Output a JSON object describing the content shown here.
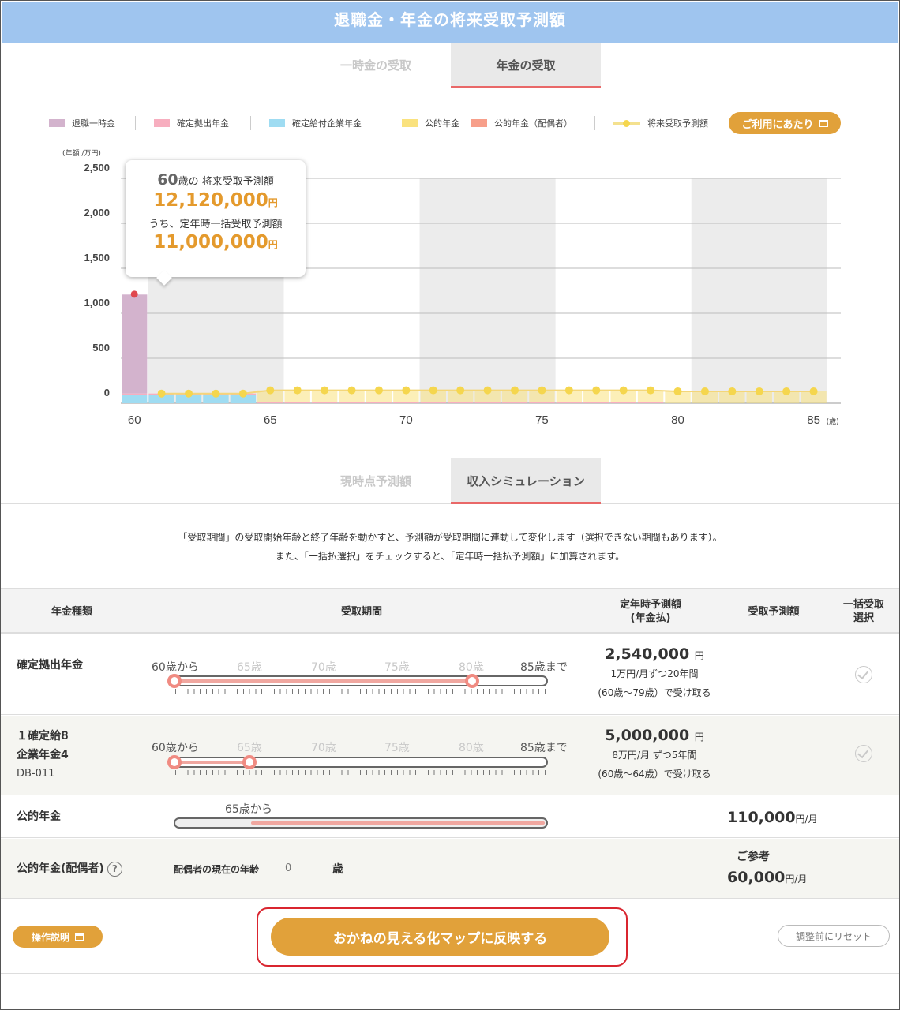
{
  "title": "退職金・年金の将来受取予測額",
  "top_tabs": [
    {
      "label": "一時金の受取",
      "active": false
    },
    {
      "label": "年金の受取",
      "active": true
    }
  ],
  "legend": {
    "items": [
      {
        "label": "退職一時金",
        "color": "#d3b3cd"
      },
      {
        "label": "確定拠出年金",
        "color": "#f7aebf"
      },
      {
        "label": "確定給付企業年金",
        "color": "#9fdcf2"
      },
      {
        "label": "公的年金",
        "color": "#fae27e"
      },
      {
        "label": "公的年金（配偶者）",
        "color": "#f79f8a"
      },
      {
        "label": "将来受取予測額",
        "color": "#f5d64e"
      }
    ],
    "usage_button": "ご利用にあたり"
  },
  "tooltip": {
    "age": "60",
    "age_suffix": "歳の 将来受取予測額",
    "total": "12,120,000",
    "yen": "円",
    "lump_label": "うち、定年時一括受取予測額",
    "lump": "11,000,000"
  },
  "chart_data": {
    "type": "bar",
    "y_unit_label": "(年額 /万円)",
    "x_unit_label": "(歳)",
    "ylim": [
      0,
      2500
    ],
    "y_ticks": [
      0,
      500,
      1000,
      1500,
      2000,
      2500
    ],
    "y_tick_labels": [
      "0",
      "500",
      "1,000",
      "1,500",
      "2,000",
      "2,500"
    ],
    "x_ticks": [
      60,
      65,
      70,
      75,
      80,
      85
    ],
    "x_tick_labels": [
      "60",
      "65",
      "70",
      "75",
      "80",
      "85"
    ],
    "xlim": [
      59.5,
      86
    ],
    "grid": true,
    "shaded_age_bands": [
      [
        60.5,
        65.5
      ],
      [
        70.5,
        75.5
      ],
      [
        80.5,
        85.5
      ]
    ],
    "series": [
      {
        "name": "退職一時金",
        "color": "#d3b3cd",
        "values": [
          {
            "age": 60,
            "value": 1100
          }
        ]
      },
      {
        "name": "確定給付企業年金",
        "color": "#9fdcf2",
        "values": [
          {
            "age": 60,
            "value": 96
          },
          {
            "age": 61,
            "value": 96
          },
          {
            "age": 62,
            "value": 96
          },
          {
            "age": 63,
            "value": 96
          },
          {
            "age": 64,
            "value": 96
          }
        ]
      },
      {
        "name": "確定拠出年金",
        "color": "#f7aebf",
        "values": [
          {
            "age": 60,
            "value": 12
          },
          {
            "age": 61,
            "value": 12
          },
          {
            "age": 62,
            "value": 12
          },
          {
            "age": 63,
            "value": 12
          },
          {
            "age": 64,
            "value": 12
          },
          {
            "age": 65,
            "value": 12
          },
          {
            "age": 66,
            "value": 12
          },
          {
            "age": 67,
            "value": 12
          },
          {
            "age": 68,
            "value": 12
          },
          {
            "age": 69,
            "value": 12
          },
          {
            "age": 70,
            "value": 12
          },
          {
            "age": 71,
            "value": 12
          },
          {
            "age": 72,
            "value": 12
          },
          {
            "age": 73,
            "value": 12
          },
          {
            "age": 74,
            "value": 12
          },
          {
            "age": 75,
            "value": 12
          },
          {
            "age": 76,
            "value": 12
          },
          {
            "age": 77,
            "value": 12
          },
          {
            "age": 78,
            "value": 12
          },
          {
            "age": 79,
            "value": 12
          }
        ]
      },
      {
        "name": "公的年金",
        "color": "#fae27e",
        "values": [
          {
            "age": 65,
            "value": 132
          },
          {
            "age": 66,
            "value": 132
          },
          {
            "age": 67,
            "value": 132
          },
          {
            "age": 68,
            "value": 132
          },
          {
            "age": 69,
            "value": 132
          },
          {
            "age": 70,
            "value": 132
          },
          {
            "age": 71,
            "value": 132
          },
          {
            "age": 72,
            "value": 132
          },
          {
            "age": 73,
            "value": 132
          },
          {
            "age": 74,
            "value": 132
          },
          {
            "age": 75,
            "value": 132
          },
          {
            "age": 76,
            "value": 132
          },
          {
            "age": 77,
            "value": 132
          },
          {
            "age": 78,
            "value": 132
          },
          {
            "age": 79,
            "value": 132
          },
          {
            "age": 80,
            "value": 132
          },
          {
            "age": 81,
            "value": 132
          },
          {
            "age": 82,
            "value": 132
          },
          {
            "age": 83,
            "value": 132
          },
          {
            "age": 84,
            "value": 132
          },
          {
            "age": 85,
            "value": 132
          }
        ]
      },
      {
        "name": "将来受取予測額",
        "type": "line",
        "color": "#f5d64e",
        "values": [
          {
            "age": 60,
            "value": 1212
          },
          {
            "age": 61,
            "value": 108
          },
          {
            "age": 62,
            "value": 108
          },
          {
            "age": 63,
            "value": 108
          },
          {
            "age": 64,
            "value": 108
          },
          {
            "age": 65,
            "value": 144
          },
          {
            "age": 66,
            "value": 144
          },
          {
            "age": 67,
            "value": 144
          },
          {
            "age": 68,
            "value": 144
          },
          {
            "age": 69,
            "value": 144
          },
          {
            "age": 70,
            "value": 144
          },
          {
            "age": 71,
            "value": 144
          },
          {
            "age": 72,
            "value": 144
          },
          {
            "age": 73,
            "value": 144
          },
          {
            "age": 74,
            "value": 144
          },
          {
            "age": 75,
            "value": 144
          },
          {
            "age": 76,
            "value": 144
          },
          {
            "age": 77,
            "value": 144
          },
          {
            "age": 78,
            "value": 144
          },
          {
            "age": 79,
            "value": 144
          },
          {
            "age": 80,
            "value": 132
          },
          {
            "age": 81,
            "value": 132
          },
          {
            "age": 82,
            "value": 132
          },
          {
            "age": 83,
            "value": 132
          },
          {
            "age": 84,
            "value": 132
          },
          {
            "age": 85,
            "value": 132
          }
        ]
      }
    ]
  },
  "sub_tabs": [
    {
      "label": "現時点予測額",
      "active": false
    },
    {
      "label": "収入シミュレーション",
      "active": true
    }
  ],
  "description": [
    "「受取期間」の受取開始年齢と終了年齢を動かすと、予測額が受取期間に連動して変化します（選択できない期間もあります）。",
    "また、「一括払選択」をチェックすると、「定年時一括払予測額」に加算されます。"
  ],
  "table": {
    "headers": {
      "type": "年金種類",
      "period": "受取期間",
      "retire1": "定年時予測額",
      "retire2": "(年金払)",
      "forecast": "受取予測額",
      "lump1": "一括受取",
      "lump2": "選択"
    },
    "scale": [
      "60歳から",
      "65歳",
      "70歳",
      "75歳",
      "80歳",
      "85歳まで"
    ],
    "rows": [
      {
        "label": "確定拠出年金",
        "amount": "2,540,000",
        "yen": "円",
        "detail1": "1万円/月ずつ20年間",
        "detail2": "(60歳〜79歳）で受け取る",
        "range_start": 60,
        "range_end": 80
      },
      {
        "label1": "１確定給8",
        "label2": "企業年金4",
        "label3": "DB-011",
        "amount": "5,000,000",
        "yen": "円",
        "detail1": "8万円/月 ずつ5年間",
        "detail2": "(60歳〜64歳）で受け取る",
        "range_start": 60,
        "range_end": 65
      }
    ],
    "public": {
      "label": "公的年金",
      "start_label": "65歳から",
      "amount": "110,000",
      "unit": "円/月",
      "range_start": 65
    },
    "spouse": {
      "label": "公的年金(配偶者)",
      "help": "?",
      "age_label": "配偶者の現在の年齢",
      "age_placeholder": "0",
      "age_unit": "歳",
      "ref_label": "ご参考",
      "amount": "60,000",
      "unit": "円/月"
    }
  },
  "buttons": {
    "operation": "操作説明",
    "apply": "おかねの見える化マップに反映する",
    "reset": "調整前にリセット"
  }
}
